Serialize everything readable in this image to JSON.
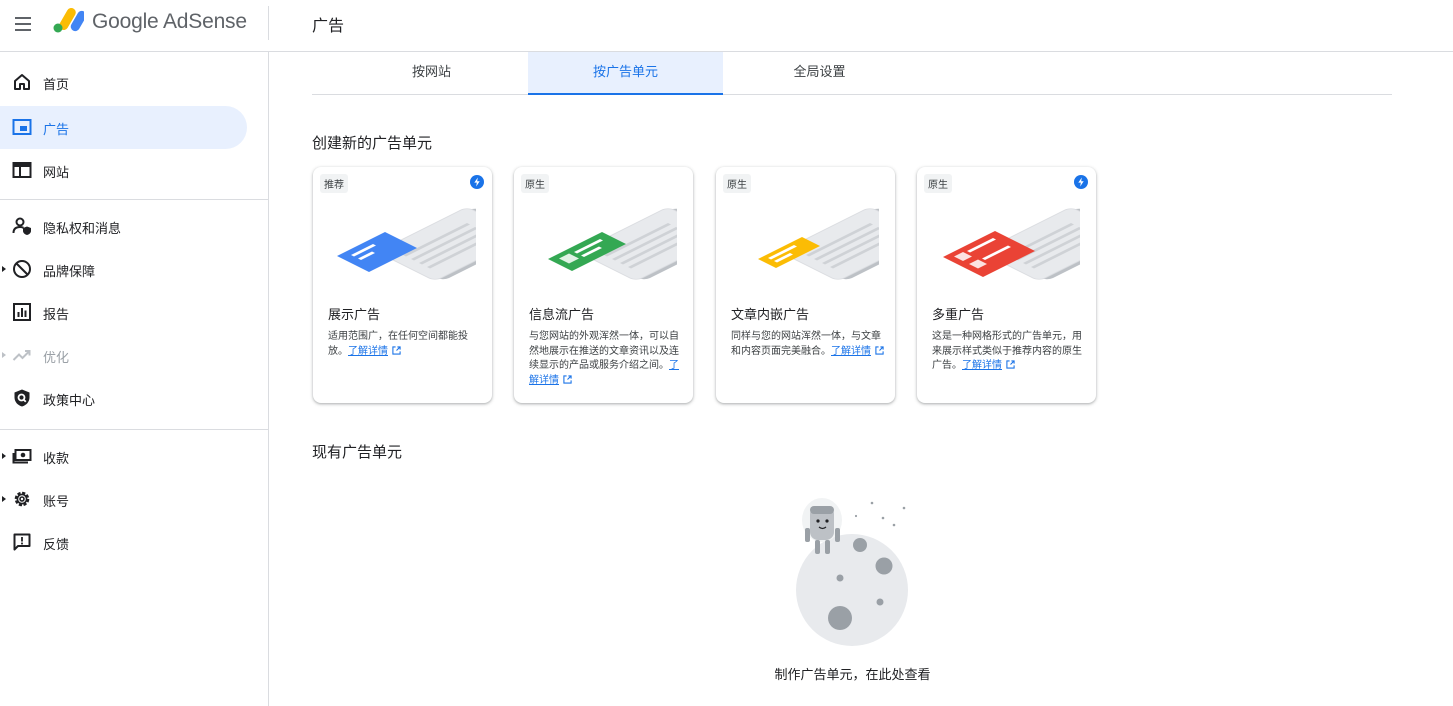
{
  "header": {
    "brand": "Google AdSense",
    "page_title": "广告"
  },
  "sidebar": {
    "items": [
      {
        "label": "首页",
        "icon": "home-icon"
      },
      {
        "label": "广告",
        "icon": "ads-icon",
        "active": true
      },
      {
        "label": "网站",
        "icon": "sites-icon"
      },
      {
        "label": "隐私权和消息",
        "icon": "privacy-icon"
      },
      {
        "label": "品牌保障",
        "icon": "block-icon",
        "expandable": true
      },
      {
        "label": "报告",
        "icon": "reports-icon"
      },
      {
        "label": "优化",
        "icon": "trending-icon",
        "expandable": true,
        "disabled": true
      },
      {
        "label": "政策中心",
        "icon": "policy-shield-icon"
      },
      {
        "label": "收款",
        "icon": "payments-icon",
        "expandable": true
      },
      {
        "label": "账号",
        "icon": "gear-icon",
        "expandable": true
      },
      {
        "label": "反馈",
        "icon": "feedback-icon"
      }
    ]
  },
  "tabs": [
    {
      "label": "按网站"
    },
    {
      "label": "按广告单元",
      "active": true
    },
    {
      "label": "全局设置"
    }
  ],
  "create_section": {
    "title": "创建新的广告单元",
    "cards": [
      {
        "badge": "推荐",
        "bolt": true,
        "title": "展示广告",
        "desc": "适用范围广，在任何空间都能投放。",
        "link": "了解详情",
        "accent": "#4285f4"
      },
      {
        "badge": "原生",
        "bolt": false,
        "title": "信息流广告",
        "desc": "与您网站的外观浑然一体，可以自然地展示在推送的文章资讯以及连续显示的产品或服务介绍之间。",
        "link": "了解详情",
        "accent": "#34a853"
      },
      {
        "badge": "原生",
        "bolt": false,
        "title": "文章内嵌广告",
        "desc": "同样与您的网站浑然一体，与文章和内容页面完美融合。",
        "link": "了解详情",
        "accent": "#fbbc04"
      },
      {
        "badge": "原生",
        "bolt": true,
        "title": "多重广告",
        "desc": "这是一种网格形式的广告单元，用来展示样式类似于推荐内容的原生广告。",
        "link": "了解详情",
        "accent": "#ea4335"
      }
    ]
  },
  "existing_section": {
    "title": "现有广告单元",
    "empty_text": "制作广告单元，在此处查看"
  }
}
